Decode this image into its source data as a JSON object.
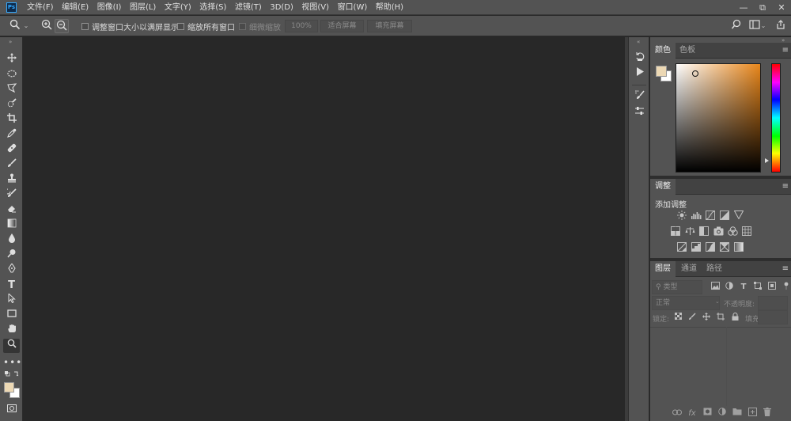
{
  "app": {
    "logo": "Ps"
  },
  "menu": [
    "文件(F)",
    "编辑(E)",
    "图像(I)",
    "图层(L)",
    "文字(Y)",
    "选择(S)",
    "滤镜(T)",
    "3D(D)",
    "视图(V)",
    "窗口(W)",
    "帮助(H)"
  ],
  "window_controls": {
    "minimize": "—",
    "restore": "⧉",
    "close": "✕"
  },
  "options": {
    "tool_icon": "zoom-icon",
    "resize_windows_label": "调整窗口大小以满屏显示",
    "zoom_all_windows_label": "缩放所有窗口",
    "scrubby_zoom_label": "细微缩放",
    "zoom_value": "100%",
    "fit_screen_label": "适合屏幕",
    "fill_screen_label": "填充屏幕"
  },
  "tools": [
    "move-tool",
    "ellipse-marquee-tool",
    "polygon-lasso-tool",
    "quick-select-tool",
    "crop-tool",
    "eyedropper-tool",
    "healing-brush-tool",
    "brush-tool",
    "clone-stamp-tool",
    "history-brush-tool",
    "eraser-tool",
    "gradient-tool",
    "blur-tool",
    "dodge-tool",
    "pen-tool",
    "type-tool",
    "path-select-tool",
    "rectangle-tool",
    "hand-tool",
    "zoom-tool"
  ],
  "tool_text_glyph": "T",
  "colors": {
    "foreground": "#ecd8b4",
    "background": "#ffffff",
    "accent": "#e8861a"
  },
  "color_panel": {
    "tabs": [
      "颜色",
      "色板"
    ]
  },
  "adjustments_panel": {
    "tabs": [
      "调整"
    ],
    "add_label": "添加调整",
    "icons": [
      [
        "brightness-contrast-icon",
        "levels-icon",
        "curves-icon",
        "exposure-icon",
        "vibrance-triangle-icon"
      ],
      [
        "hue-saturation-icon",
        "color-balance-icon",
        "black-white-icon",
        "photo-filter-icon",
        "channel-mixer-icon",
        "color-lookup-icon"
      ],
      [
        "invert-icon",
        "posterize-icon",
        "threshold-icon",
        "selective-color-icon",
        "gradient-map-icon"
      ]
    ]
  },
  "layers_panel": {
    "tabs": [
      "图层",
      "通道",
      "路径"
    ],
    "filter_label": "类型",
    "blend_mode": "正常",
    "opacity_label": "不透明度:",
    "lock_label": "锁定:",
    "fill_label": "填充:",
    "footer_fx": "fx"
  }
}
